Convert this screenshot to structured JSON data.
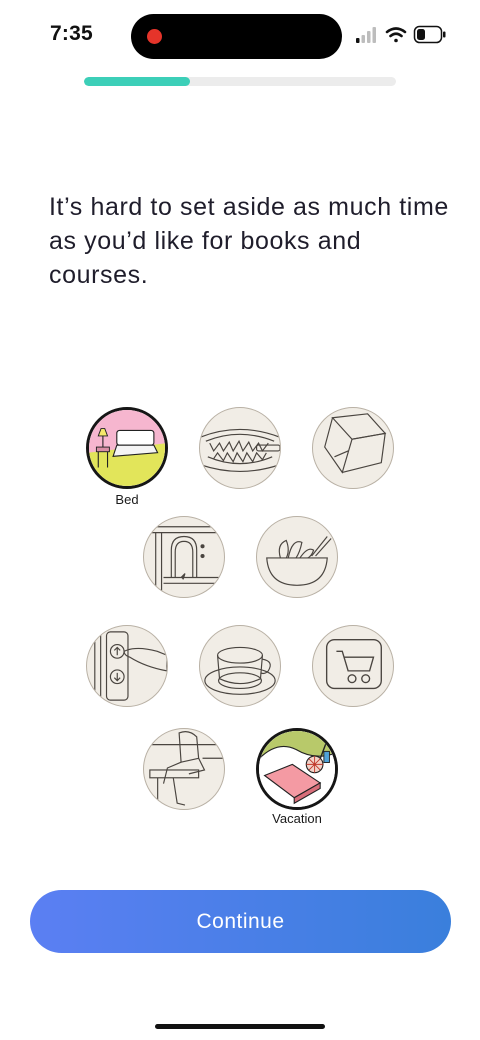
{
  "status_bar": {
    "time": "7:35",
    "recording_indicator_color": "#e5342a",
    "icons": [
      "cellular-signal-icon",
      "wifi-icon",
      "battery-icon"
    ]
  },
  "progress": {
    "value": 0.34,
    "fill_color": "#3ccfb8",
    "track_color": "#ececec"
  },
  "headline": "It’s hard to set aside as much time as you’d like for books and courses.",
  "options": [
    {
      "id": "bed",
      "label": "Bed",
      "selected": true,
      "icon": "bed-icon"
    },
    {
      "id": "teeth",
      "label": "",
      "selected": false,
      "icon": "teeth-brushing-icon"
    },
    {
      "id": "box",
      "label": "",
      "selected": false,
      "icon": "box-icon"
    },
    {
      "id": "fireplace",
      "label": "",
      "selected": false,
      "icon": "fireplace-icon"
    },
    {
      "id": "cooking",
      "label": "",
      "selected": false,
      "icon": "mixing-bowl-icon"
    },
    {
      "id": "elevator",
      "label": "",
      "selected": false,
      "icon": "elevator-buttons-icon"
    },
    {
      "id": "coffee",
      "label": "",
      "selected": false,
      "icon": "coffee-cup-icon"
    },
    {
      "id": "shopping",
      "label": "",
      "selected": false,
      "icon": "shopping-cart-icon"
    },
    {
      "id": "commute",
      "label": "",
      "selected": false,
      "icon": "seated-person-icon"
    },
    {
      "id": "vacation",
      "label": "Vacation",
      "selected": true,
      "icon": "beach-towel-icon"
    }
  ],
  "continue_button": {
    "label": "Continue"
  }
}
